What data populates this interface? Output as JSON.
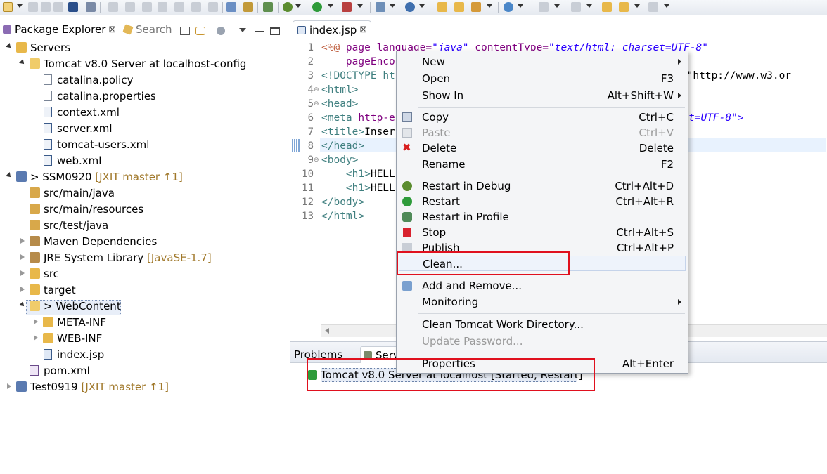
{
  "package_explorer": {
    "tab_label": "Package Explorer",
    "close_glyph": "⊠",
    "search_tab_label": "Search"
  },
  "tree": [
    {
      "label": "Servers",
      "deco": ""
    },
    {
      "label": "Tomcat v8.0 Server at localhost-config",
      "deco": ""
    },
    {
      "label": "catalina.policy",
      "deco": ""
    },
    {
      "label": "catalina.properties",
      "deco": ""
    },
    {
      "label": "context.xml",
      "deco": ""
    },
    {
      "label": "server.xml",
      "deco": ""
    },
    {
      "label": "tomcat-users.xml",
      "deco": ""
    },
    {
      "label": "web.xml",
      "deco": ""
    },
    {
      "label": "> SSM0920",
      "deco": "[JXIT master ↑1]"
    },
    {
      "label": "src/main/java",
      "deco": ""
    },
    {
      "label": "src/main/resources",
      "deco": ""
    },
    {
      "label": "src/test/java",
      "deco": ""
    },
    {
      "label": "Maven Dependencies",
      "deco": ""
    },
    {
      "label": "JRE System Library",
      "deco": "[JavaSE-1.7]"
    },
    {
      "label": "src",
      "deco": ""
    },
    {
      "label": "target",
      "deco": ""
    },
    {
      "label": "> WebContent",
      "deco": ""
    },
    {
      "label": "META-INF",
      "deco": ""
    },
    {
      "label": "WEB-INF",
      "deco": ""
    },
    {
      "label": "index.jsp",
      "deco": ""
    },
    {
      "label": "pom.xml",
      "deco": ""
    },
    {
      "label": "Test0919",
      "deco": "[JXIT master ↑1]"
    }
  ],
  "editor": {
    "tab_label": "index.jsp",
    "close_glyph": "⊠",
    "line_numbers": [
      "1",
      "2",
      "3",
      "4",
      "5",
      "6",
      "7",
      "8",
      "9",
      "10",
      "11",
      "12",
      "13"
    ],
    "lines": [
      {
        "a": "<%@ ",
        "b": "page ",
        "c": "language=",
        "d": "\"java\"",
        "e": " contentType=",
        "f": "\"text/html; charset=UTF-8\""
      },
      {
        "a": "    ",
        "b": "pageEnco",
        "c": "",
        "d": "",
        "e": "",
        "f": ""
      },
      {
        "a": "<!DOCTYPE ",
        "b": "ht",
        "c": "",
        "d": "",
        "e": "",
        "f": "/EN\" \"http://www.w3.or"
      },
      {
        "a": "<html>",
        "b": "",
        "c": "",
        "d": "",
        "e": "",
        "f": ""
      },
      {
        "a": "<head>",
        "b": "",
        "c": "",
        "d": "",
        "e": "",
        "f": ""
      },
      {
        "a": "<meta ",
        "b": "http-e",
        "c": "",
        "d": "",
        "e": "",
        "f": "t=UTF-8\">"
      },
      {
        "a": "<title>",
        "b": "Inser",
        "c": "",
        "d": "",
        "e": "",
        "f": ""
      },
      {
        "a": "</head>",
        "b": "",
        "c": "",
        "d": "",
        "e": "",
        "f": ""
      },
      {
        "a": "<body>",
        "b": "",
        "c": "",
        "d": "",
        "e": "",
        "f": ""
      },
      {
        "a": "    <h1>",
        "b": "HELL",
        "c": "",
        "d": "",
        "e": "",
        "f": ""
      },
      {
        "a": "    <h1>",
        "b": "HELL",
        "c": "",
        "d": "",
        "e": "",
        "f": ""
      },
      {
        "a": "</body>",
        "b": "",
        "c": "",
        "d": "",
        "e": "",
        "f": ""
      },
      {
        "a": "</html>",
        "b": "",
        "c": "",
        "d": "",
        "e": "",
        "f": ""
      }
    ]
  },
  "bottom_panel": {
    "problems_tab": "Problems",
    "servers_tab": "Serv",
    "server_entry": "Tomcat v8.0 Server at localhost  [Started, Restart]"
  },
  "context_menu": {
    "items": [
      {
        "label": "New",
        "accel": "",
        "submenu": true,
        "disabled": false
      },
      {
        "label": "Open",
        "accel": "F3",
        "submenu": false,
        "disabled": false
      },
      {
        "label": "Show In",
        "accel": "Alt+Shift+W",
        "submenu": true,
        "disabled": false
      },
      {
        "label": "Copy",
        "accel": "Ctrl+C",
        "submenu": false,
        "disabled": false
      },
      {
        "label": "Paste",
        "accel": "Ctrl+V",
        "submenu": false,
        "disabled": true
      },
      {
        "label": "Delete",
        "accel": "Delete",
        "submenu": false,
        "disabled": false
      },
      {
        "label": "Rename",
        "accel": "F2",
        "submenu": false,
        "disabled": false
      },
      {
        "label": "Restart in Debug",
        "accel": "Ctrl+Alt+D",
        "submenu": false,
        "disabled": false
      },
      {
        "label": "Restart",
        "accel": "Ctrl+Alt+R",
        "submenu": false,
        "disabled": false
      },
      {
        "label": "Restart in Profile",
        "accel": "",
        "submenu": false,
        "disabled": false
      },
      {
        "label": "Stop",
        "accel": "Ctrl+Alt+S",
        "submenu": false,
        "disabled": false
      },
      {
        "label": "Publish",
        "accel": "Ctrl+Alt+P",
        "submenu": false,
        "disabled": false
      },
      {
        "label": "Clean...",
        "accel": "",
        "submenu": false,
        "disabled": false
      },
      {
        "label": "Add and Remove...",
        "accel": "",
        "submenu": false,
        "disabled": false
      },
      {
        "label": "Monitoring",
        "accel": "",
        "submenu": true,
        "disabled": false
      },
      {
        "label": "Clean Tomcat Work Directory...",
        "accel": "",
        "submenu": false,
        "disabled": false
      },
      {
        "label": "Update Password...",
        "accel": "",
        "submenu": false,
        "disabled": true
      },
      {
        "label": "Properties",
        "accel": "Alt+Enter",
        "submenu": false,
        "disabled": false
      }
    ]
  },
  "colors": {
    "annotation_red": "#e0101e",
    "menu_bg": "#f4f5f7",
    "folder": "#e8b84a",
    "server_green": "#2e9b3a"
  }
}
